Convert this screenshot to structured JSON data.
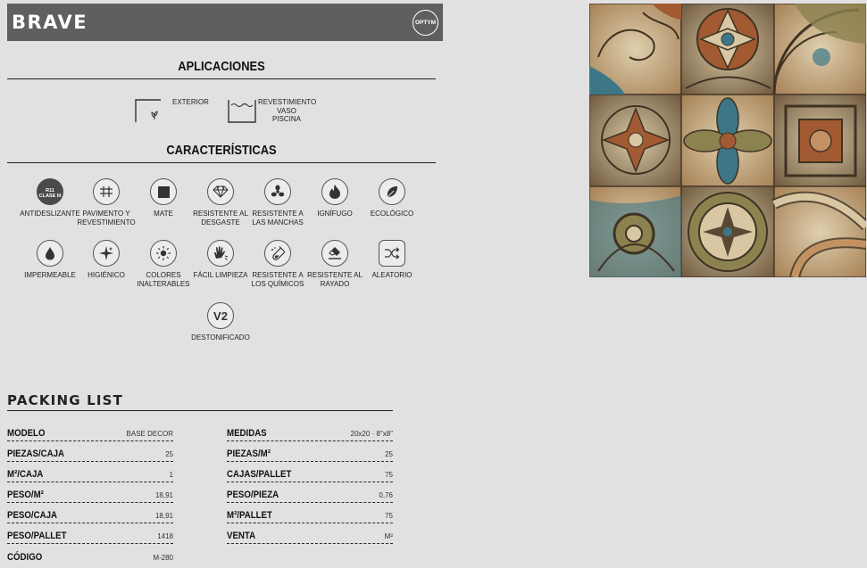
{
  "header": {
    "product_name": "BRAVE",
    "brand_logo": "OPTYM"
  },
  "aplicaciones": {
    "title": "APLICACIONES",
    "items": [
      {
        "icon": "exterior-icon",
        "label": "EXTERIOR"
      },
      {
        "icon": "pool-icon",
        "label": "REVESTIMIENTO\nVASO\nPISCINA"
      }
    ]
  },
  "caracteristicas": {
    "title": "CARACTERÍSTICAS",
    "items": [
      {
        "icon": "r11-badge-icon",
        "badge_line1": "R11",
        "badge_line2": "CLASE III",
        "label": "ANTIDESLIZANTE"
      },
      {
        "icon": "floor-wall-icon",
        "label": "PAVIMENTO Y\nREVESTIMIENTO"
      },
      {
        "icon": "matte-icon",
        "label": "MATE"
      },
      {
        "icon": "diamond-icon",
        "label": "RESISTENTE AL\nDESGASTE"
      },
      {
        "icon": "stain-resistant-icon",
        "label": "RESISTENTE A\nLAS MANCHAS"
      },
      {
        "icon": "flame-icon",
        "label": "IGNÍFUGO"
      },
      {
        "icon": "leaf-icon",
        "label": "ECOLÓGICO"
      },
      {
        "icon": "water-drop-icon",
        "label": "IMPERMEABLE"
      },
      {
        "icon": "sparkle-icon",
        "label": "HIGIÉNICO"
      },
      {
        "icon": "sun-icon",
        "label": "COLORES\nINALTERABLES"
      },
      {
        "icon": "hand-clean-icon",
        "label": "FÁCIL LIMPIEZA"
      },
      {
        "icon": "test-tube-icon",
        "label": "RESISTENTE A\nLOS QUÍMICOS"
      },
      {
        "icon": "scratch-icon",
        "label": "RESISTENTE AL\nRAYADO"
      },
      {
        "icon": "shuffle-icon",
        "label": "ALEATORIO"
      },
      {
        "icon": "v2-icon",
        "badge": "V2",
        "label": "DESTONIFICADO"
      }
    ]
  },
  "packing_list": {
    "title": "PACKING LIST",
    "left": [
      {
        "key": "MODELO",
        "value": "BASE DECOR"
      },
      {
        "key": "PIEZAS/CAJA",
        "value": "25"
      },
      {
        "key": "M²/CAJA",
        "value": "1"
      },
      {
        "key": "PESO/M²",
        "value": "18,91"
      },
      {
        "key": "PESO/CAJA",
        "value": "18,91"
      },
      {
        "key": "PESO/PALLET",
        "value": "1418"
      },
      {
        "key": "CÓDIGO",
        "value": "M-280"
      }
    ],
    "right": [
      {
        "key": "MEDIDAS",
        "value": "20x20 · 8\"x8\""
      },
      {
        "key": "PIEZAS/M²",
        "value": "25"
      },
      {
        "key": "CAJAS/PALLET",
        "value": "75"
      },
      {
        "key": "PESO/PIEZA",
        "value": "0,76"
      },
      {
        "key": "M²/PALLET",
        "value": "75"
      },
      {
        "key": "VENTA",
        "value": "M²"
      }
    ]
  },
  "colors": {
    "header_bg": "#5f5f5f",
    "page_bg": "#e1e1e1",
    "tile_palette": [
      "#d9c7a3",
      "#a15a32",
      "#3d7787",
      "#8c8250",
      "#5a4834",
      "#c49262"
    ]
  }
}
